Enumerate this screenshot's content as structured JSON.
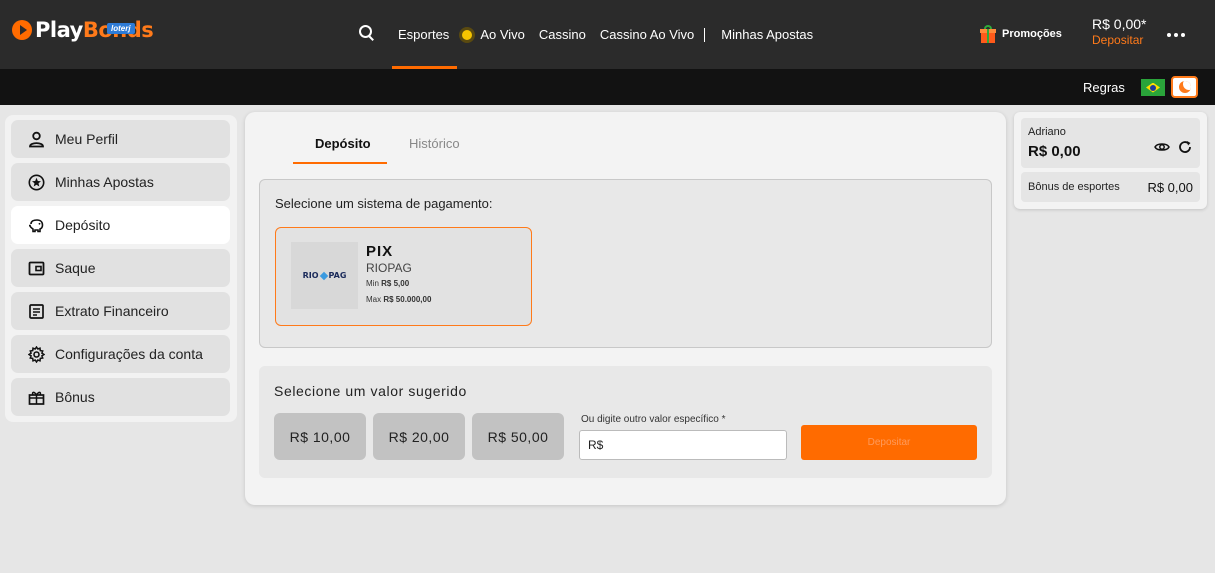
{
  "brand": {
    "name_play": "Play",
    "name_bonds": "Bonds",
    "sub": "loterj"
  },
  "nav": {
    "items": [
      {
        "label": "Esportes"
      },
      {
        "label": "Ao Vivo"
      },
      {
        "label": "Cassino"
      },
      {
        "label": "Cassino Ao Vivo"
      },
      {
        "label": "Minhas Apostas"
      }
    ],
    "active": "Esportes"
  },
  "header": {
    "promo_label": "Promoções",
    "balance": "R$ 0,00*",
    "deposit_label": "Depositar",
    "rules_label": "Regras"
  },
  "sidebar": {
    "items": [
      {
        "label": "Meu Perfil",
        "icon": "user-icon"
      },
      {
        "label": "Minhas Apostas",
        "icon": "star-icon"
      },
      {
        "label": "Depósito",
        "icon": "piggy-bank-icon"
      },
      {
        "label": "Saque",
        "icon": "wallet-icon"
      },
      {
        "label": "Extrato Financeiro",
        "icon": "statement-icon"
      },
      {
        "label": "Configurações da conta",
        "icon": "gear-icon"
      },
      {
        "label": "Bônus",
        "icon": "gift-icon"
      }
    ],
    "active": "Depósito"
  },
  "main": {
    "tabs": [
      {
        "label": "Depósito"
      },
      {
        "label": "Histórico"
      }
    ],
    "payment_title": "Selecione um sistema de pagamento:",
    "method": {
      "logo_text_left": "RIO",
      "logo_text_right": "PAG",
      "name": "PIX",
      "provider": "RIOPAG",
      "min_label": "Min",
      "min_value": "R$ 5,00",
      "max_label": "Max",
      "max_value": "R$ 50.000,00"
    },
    "value_title": "Selecione um valor sugerido",
    "chips": [
      "R$ 10,00",
      "R$ 20,00",
      "R$ 50,00"
    ],
    "field_label": "Ou digite outro valor específico *",
    "field_value": "R$",
    "deposit_button": "Depositar"
  },
  "account": {
    "name": "Adriano",
    "balance": "R$ 0,00",
    "bonus_label": "Bônus de esportes",
    "bonus_value": "R$ 0,00"
  },
  "colors": {
    "accent": "#ff6b00",
    "topbar": "#2b2b2b",
    "subbar": "#121212"
  }
}
